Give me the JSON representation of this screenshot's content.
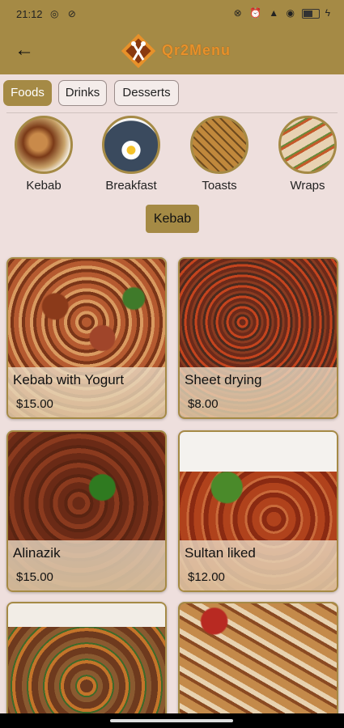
{
  "status": {
    "time": "21:12"
  },
  "app": {
    "brand": "Qr2Menu"
  },
  "tabs": [
    {
      "label": "Foods",
      "active": true
    },
    {
      "label": "Drinks",
      "active": false
    },
    {
      "label": "Desserts",
      "active": false
    }
  ],
  "categories": [
    {
      "label": "Kebab",
      "icon": "kebab-photo"
    },
    {
      "label": "Breakfast",
      "icon": "breakfast-photo"
    },
    {
      "label": "Toasts",
      "icon": "toasts-photo"
    },
    {
      "label": "Wraps",
      "icon": "wraps-photo"
    }
  ],
  "selected_category": "Kebab",
  "items": [
    {
      "name": "Kebab with Yogurt",
      "price": "$15.00"
    },
    {
      "name": "Sheet drying",
      "price": "$8.00"
    },
    {
      "name": "Alinazik",
      "price": "$15.00"
    },
    {
      "name": "Sultan liked",
      "price": "$12.00"
    },
    {
      "name": "",
      "price": ""
    },
    {
      "name": "",
      "price": ""
    }
  ],
  "colors": {
    "accent": "#a58a45",
    "background": "#eedfdd",
    "brand_text": "#e8912a"
  }
}
